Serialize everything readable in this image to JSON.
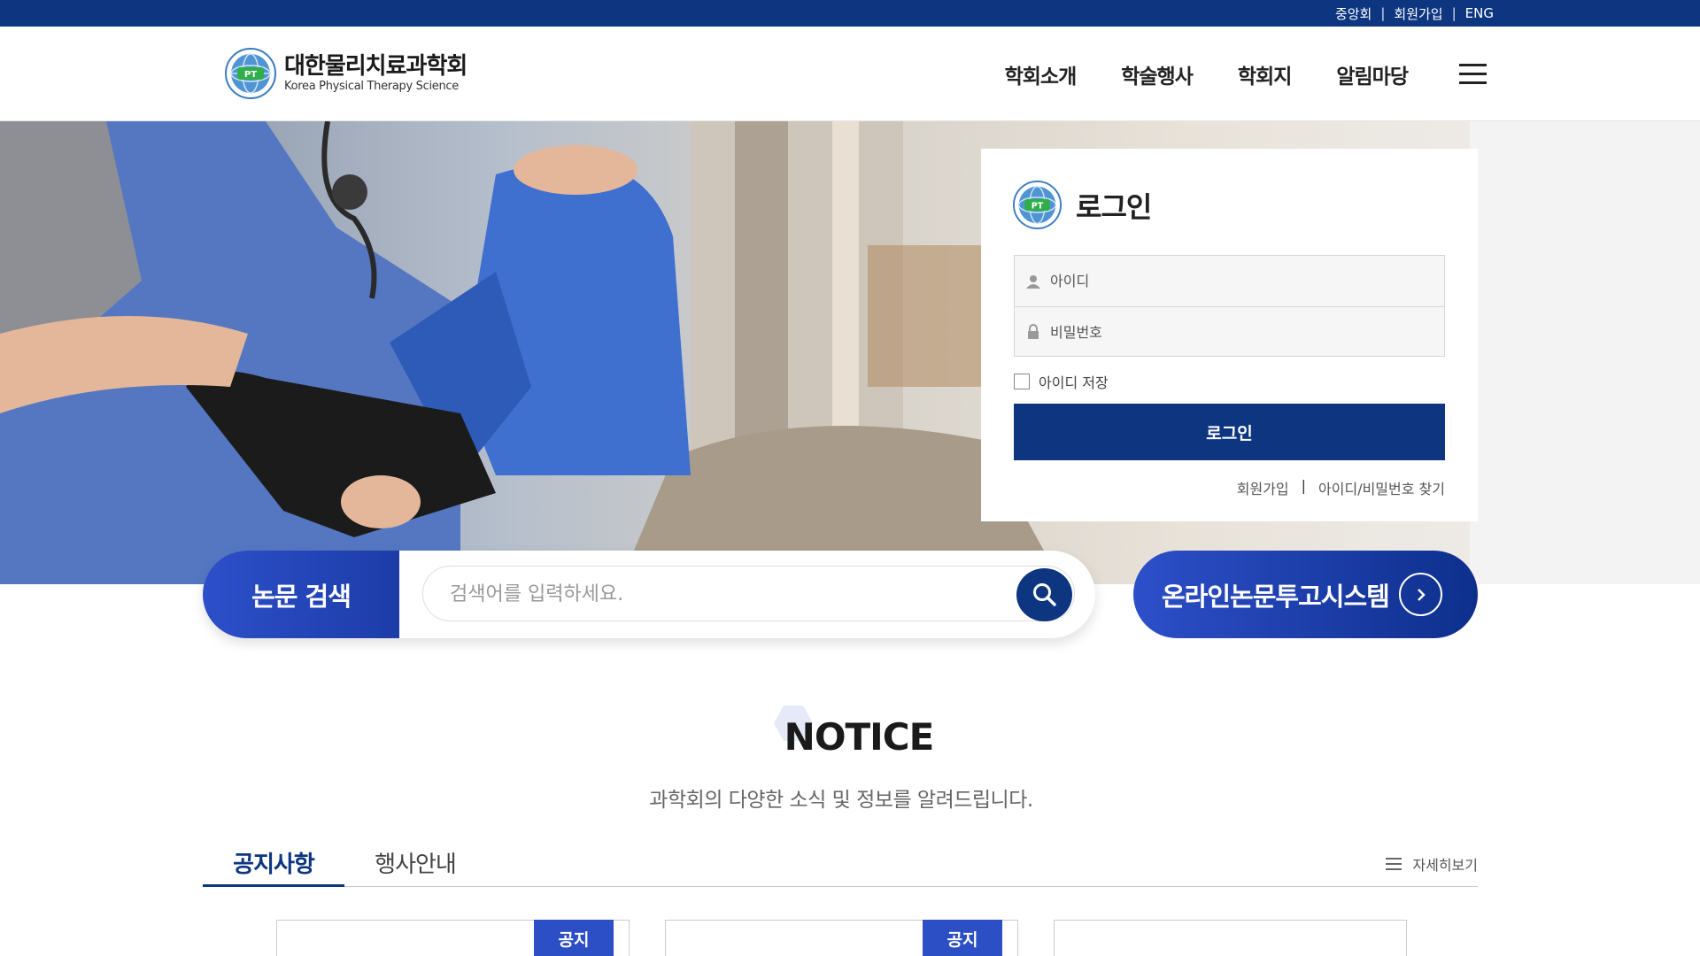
{
  "topbar": {
    "links": [
      "중앙회",
      "회원가입",
      "ENG"
    ],
    "bg_color": "#0d3580"
  },
  "header": {
    "logo_ko": "대한물리치료과학회",
    "logo_en": "Korea Physical Therapy Science",
    "nav": [
      "학회소개",
      "학술행사",
      "학회지",
      "알림마당"
    ],
    "menu_icon": "hamburger-icon"
  },
  "login": {
    "title": "로그인",
    "id_placeholder": "아이디",
    "pw_placeholder": "비밀번호",
    "remember_label": "아이디 저장",
    "button_label": "로그인",
    "signup_link": "회원가입",
    "find_link": "아이디/비밀번호 찾기"
  },
  "search": {
    "label": "논문 검색",
    "placeholder": "검색어를 입력하세요.",
    "submit_system_label": "온라인논문투고시스템"
  },
  "notice": {
    "title": "NOTICE",
    "subtitle": "과학회의 다양한 소식 및 정보를 알려드립니다.",
    "tabs": [
      "공지사항",
      "행사안내"
    ],
    "more_label": "자세히보기",
    "cards": [
      {
        "badge": "공지"
      },
      {
        "badge": "공지"
      },
      {
        "badge": ""
      }
    ]
  },
  "colors": {
    "primary": "#0d3580",
    "accent": "#2d4fc9"
  }
}
